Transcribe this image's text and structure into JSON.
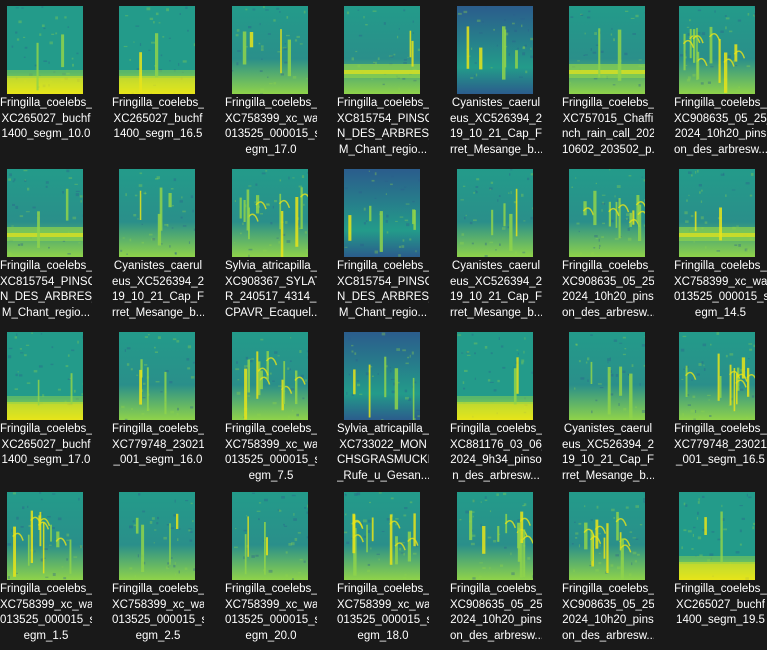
{
  "colors": {
    "background": "#191919",
    "text": "#ffffff",
    "spec_dark": "#2b5c8c",
    "spec_mid": "#239b8a",
    "spec_light": "#8fd34a",
    "spec_bright": "#e7e419"
  },
  "icon": "spectrogram-image-thumbnail",
  "files": [
    {
      "lines": [
        "Fringilla_coelebs_",
        "XC265027_buchf",
        "1400_segm_10.0"
      ],
      "style": "low"
    },
    {
      "lines": [
        "Fringilla_coelebs_",
        "XC265027_buchf",
        "1400_segm_16.5"
      ],
      "style": "low"
    },
    {
      "lines": [
        "Fringilla_coelebs_",
        "XC758399_xc_wa",
        "013525_000015_s",
        "egm_17.0"
      ],
      "style": "sparse"
    },
    {
      "lines": [
        "Fringilla_coelebs_",
        "XC815754_PINSO",
        "N_DES_ARBRES_",
        "M_Chant_regio..."
      ],
      "style": "band"
    },
    {
      "lines": [
        "Cyanistes_caerul",
        "eus_XC526394_20",
        "19_10_21_Cap_Fe",
        "rret_Mesange_b..."
      ],
      "style": "dark"
    },
    {
      "lines": [
        "Fringilla_coelebs_",
        "XC757015_Chaffi",
        "nch_rain_call_202",
        "10602_203502_p..."
      ],
      "style": "band"
    },
    {
      "lines": [
        "Fringilla_coelebs_",
        "XC908635_05_25_",
        "2024_10h20_pins",
        "on_des_arbresw..."
      ],
      "style": "busy"
    },
    {
      "lines": [
        "Fringilla_coelebs_",
        "XC815754_PINSO",
        "N_DES_ARBRES_",
        "M_Chant_regio..."
      ],
      "style": "band"
    },
    {
      "lines": [
        "Cyanistes_caerul",
        "eus_XC526394_20",
        "19_10_21_Cap_Fe",
        "rret_Mesange_b..."
      ],
      "style": "sparse"
    },
    {
      "lines": [
        "Sylvia_atricapilla_",
        "XC908367_SYLAT",
        "R_240517_4314_C",
        "CPAVR_Ecaquel..."
      ],
      "style": "busy"
    },
    {
      "lines": [
        "Fringilla_coelebs_",
        "XC815754_PINSO",
        "N_DES_ARBRES_",
        "M_Chant_regio..."
      ],
      "style": "dark"
    },
    {
      "lines": [
        "Cyanistes_caerul",
        "eus_XC526394_20",
        "19_10_21_Cap_Fe",
        "rret_Mesange_b..."
      ],
      "style": "sparse"
    },
    {
      "lines": [
        "Fringilla_coelebs_",
        "XC908635_05_25_",
        "2024_10h20_pins",
        "on_des_arbresw..."
      ],
      "style": "busy"
    },
    {
      "lines": [
        "Fringilla_coelebs_",
        "XC758399_xc_wa",
        "013525_000015_s",
        "egm_14.5"
      ],
      "style": "band"
    },
    {
      "lines": [
        "Fringilla_coelebs_",
        "XC265027_buchf",
        "1400_segm_17.0"
      ],
      "style": "low"
    },
    {
      "lines": [
        "Fringilla_coelebs_",
        "XC779748_230211",
        "_001_segm_16.0"
      ],
      "style": "sparse"
    },
    {
      "lines": [
        "Fringilla_coelebs_",
        "XC758399_xc_wa",
        "013525_000015_s",
        "egm_7.5"
      ],
      "style": "busy"
    },
    {
      "lines": [
        "Sylvia_atricapilla_",
        "XC733022_MON",
        "CHSGRASMUCKE",
        "_Rufe_u_Gesan..."
      ],
      "style": "dark"
    },
    {
      "lines": [
        "Fringilla_coelebs_",
        "XC881176_03_06_",
        "2024_9h34_pinso",
        "n_des_arbresw..."
      ],
      "style": "low"
    },
    {
      "lines": [
        "Cyanistes_caerul",
        "eus_XC526394_20",
        "19_10_21_Cap_Fe",
        "rret_Mesange_b..."
      ],
      "style": "sparse"
    },
    {
      "lines": [
        "Fringilla_coelebs_",
        "XC779748_230211",
        "_001_segm_16.5"
      ],
      "style": "busy"
    },
    {
      "lines": [
        "Fringilla_coelebs_",
        "XC758399_xc_wa",
        "013525_000015_s",
        "egm_1.5"
      ],
      "style": "busy"
    },
    {
      "lines": [
        "Fringilla_coelebs_",
        "XC758399_xc_wa",
        "013525_000015_s",
        "egm_2.5"
      ],
      "style": "sparse"
    },
    {
      "lines": [
        "Fringilla_coelebs_",
        "XC758399_xc_wa",
        "013525_000015_s",
        "egm_20.0"
      ],
      "style": "sparse"
    },
    {
      "lines": [
        "Fringilla_coelebs_",
        "XC758399_xc_wa",
        "013525_000015_s",
        "egm_18.0"
      ],
      "style": "busy"
    },
    {
      "lines": [
        "Fringilla_coelebs_",
        "XC908635_05_25_",
        "2024_10h20_pins",
        "on_des_arbresw..."
      ],
      "style": "busy"
    },
    {
      "lines": [
        "Fringilla_coelebs_",
        "XC908635_05_25_",
        "2024_10h20_pins",
        "on_des_arbresw..."
      ],
      "style": "busy"
    },
    {
      "lines": [
        "Fringilla_coelebs_",
        "XC265027_buchf",
        "1400_segm_19.5"
      ],
      "style": "low"
    }
  ]
}
